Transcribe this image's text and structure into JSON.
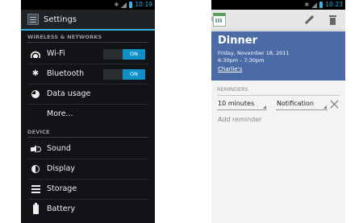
{
  "settings_screen": {
    "status": {
      "time": "10:19"
    },
    "title": "Settings",
    "sections": [
      {
        "header": "WIRELESS & NETWORKS",
        "items": [
          {
            "label": "Wi-Fi",
            "icon": "wifi-icon",
            "toggle": "ON"
          },
          {
            "label": "Bluetooth",
            "icon": "bluetooth-icon",
            "toggle": "ON"
          },
          {
            "label": "Data usage",
            "icon": "data-usage-icon"
          },
          {
            "label": "More..."
          }
        ]
      },
      {
        "header": "DEVICE",
        "items": [
          {
            "label": "Sound",
            "icon": "sound-icon"
          },
          {
            "label": "Display",
            "icon": "display-icon"
          },
          {
            "label": "Storage",
            "icon": "storage-icon"
          },
          {
            "label": "Battery",
            "icon": "battery-icon"
          }
        ]
      }
    ]
  },
  "event_screen": {
    "status": {
      "time": "10:23"
    },
    "actions": {
      "edit_icon": "pencil-icon",
      "delete_icon": "trash-icon"
    },
    "event": {
      "title": "Dinner",
      "date": "Friday, November 18, 2011",
      "time": "6:30pm – 7:30pm",
      "calendar": "Charlie's"
    },
    "reminders": {
      "header": "REMINDERS",
      "items": [
        {
          "time": "10 minutes",
          "method": "Notification"
        }
      ],
      "add_label": "Add reminder"
    }
  },
  "colors": {
    "accent": "#33b5e5",
    "toggle_on": "#0e8fc6",
    "event_header": "#4a6ba5",
    "settings_bg": "#111316"
  }
}
